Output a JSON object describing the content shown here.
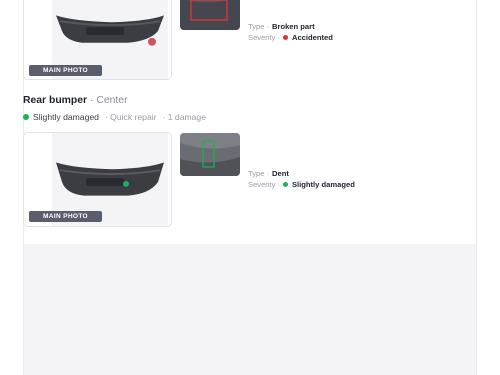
{
  "colors": {
    "accident_red": "#e0303a",
    "slight_green": "#17b25c",
    "badge_bg": "#5b5d6c"
  },
  "damage_top": {
    "photo_badge": "MAIN PHOTO",
    "type_label": "Type",
    "type_value": "Broken part",
    "severity_label": "Severity",
    "severity_value": "Accidented",
    "severity_color": "#e0303a"
  },
  "section": {
    "part": "Rear bumper",
    "separator": "·",
    "location": "Center",
    "status": "Slightly damaged",
    "status_color": "#17b25c",
    "repair": "· Quick repair",
    "damage_count": "· 1 damage"
  },
  "damage_bottom": {
    "photo_badge": "MAIN PHOTO",
    "type_label": "Type",
    "type_value": "Dent",
    "severity_label": "Severity",
    "severity_value": "Slightly damaged",
    "severity_color": "#17b25c"
  }
}
